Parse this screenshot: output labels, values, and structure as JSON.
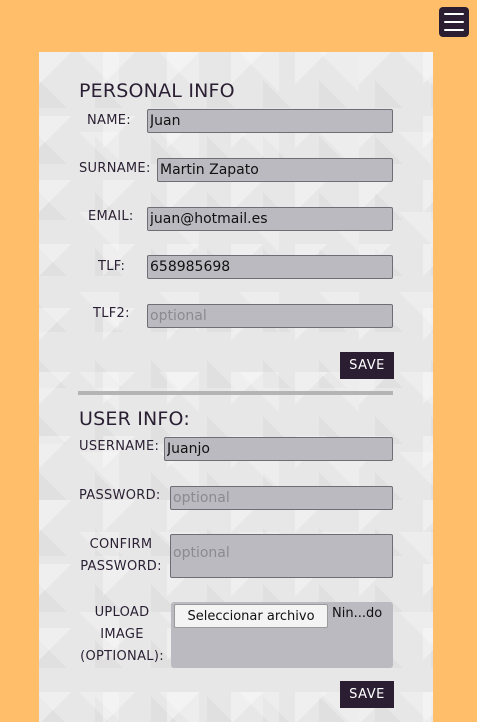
{
  "menu": {
    "icon": "hamburger-menu-icon"
  },
  "personal": {
    "title": "PERSONAL INFO",
    "name_label": "NAME:",
    "name_value": "Juan",
    "surname_label": "SURNAME:",
    "surname_value": "Martin Zapato",
    "email_label": "EMAIL:",
    "email_value": "juan@hotmail.es",
    "tlf_label": "TLF:",
    "tlf_value": "658985698",
    "tlf2_label": "TLF2:",
    "tlf2_placeholder": "optional",
    "save_label": "SAVE"
  },
  "user": {
    "title": "USER INFO:",
    "username_label": "USERNAME:",
    "username_value": "Juanjo",
    "password_label": "PASSWORD:",
    "password_placeholder": "optional",
    "confirm_label_1": "CONFIRM",
    "confirm_label_2": "PASSWORD:",
    "confirm_placeholder": "optional",
    "upload_label_1": "UPLOAD",
    "upload_label_2": "IMAGE",
    "upload_label_3": "(OPTIONAL):",
    "file_button": "Seleccionar archivo",
    "file_status": "Nin...do",
    "save_label": "SAVE"
  },
  "colors": {
    "background": "#FFBE6A",
    "panel": "#E7E7E7",
    "accent": "#2B1E33",
    "field": "#BABAC0"
  }
}
